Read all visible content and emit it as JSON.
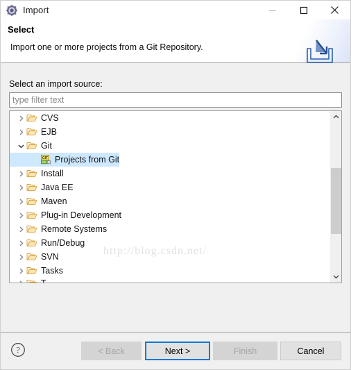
{
  "window": {
    "title": "Import",
    "icon": "eclipse-gear-icon",
    "controls": {
      "minimize": "minimize-icon",
      "maximize": "maximize-icon",
      "close": "close-icon"
    }
  },
  "header": {
    "title": "Select",
    "description": "Import one or more projects from a Git Repository.",
    "banner_icon": "import-arrow-icon"
  },
  "main": {
    "source_label": "Select an import source:",
    "filter": {
      "value": "",
      "placeholder": "type filter text"
    },
    "watermark": "http://blog.csdn.net/",
    "tree": [
      {
        "label": "CVS",
        "level": 0,
        "icon": "folder-icon",
        "expanded": false,
        "selected": false,
        "has_twisty": true
      },
      {
        "label": "EJB",
        "level": 0,
        "icon": "folder-icon",
        "expanded": false,
        "selected": false,
        "has_twisty": true
      },
      {
        "label": "Git",
        "level": 0,
        "icon": "folder-icon",
        "expanded": true,
        "selected": false,
        "has_twisty": true
      },
      {
        "label": "Projects from Git",
        "level": 1,
        "icon": "git-icon",
        "expanded": false,
        "selected": true,
        "has_twisty": false
      },
      {
        "label": "Install",
        "level": 0,
        "icon": "folder-icon",
        "expanded": false,
        "selected": false,
        "has_twisty": true
      },
      {
        "label": "Java EE",
        "level": 0,
        "icon": "folder-icon",
        "expanded": false,
        "selected": false,
        "has_twisty": true
      },
      {
        "label": "Maven",
        "level": 0,
        "icon": "folder-icon",
        "expanded": false,
        "selected": false,
        "has_twisty": true
      },
      {
        "label": "Plug-in Development",
        "level": 0,
        "icon": "folder-icon",
        "expanded": false,
        "selected": false,
        "has_twisty": true
      },
      {
        "label": "Remote Systems",
        "level": 0,
        "icon": "folder-icon",
        "expanded": false,
        "selected": false,
        "has_twisty": true
      },
      {
        "label": "Run/Debug",
        "level": 0,
        "icon": "folder-icon",
        "expanded": false,
        "selected": false,
        "has_twisty": true
      },
      {
        "label": "SVN",
        "level": 0,
        "icon": "folder-icon",
        "expanded": false,
        "selected": false,
        "has_twisty": true
      },
      {
        "label": "Tasks",
        "level": 0,
        "icon": "folder-icon",
        "expanded": false,
        "selected": false,
        "has_twisty": true
      }
    ],
    "tree_partial_row": {
      "label": "T",
      "level": 0,
      "icon": "folder-icon"
    },
    "scrollbar": {
      "up": "chevron-up-icon",
      "down": "chevron-down-icon",
      "thumb_position_pct": 33
    }
  },
  "footer": {
    "help_icon": "help-question-icon",
    "buttons": [
      {
        "name": "back",
        "label": "< Back",
        "state": "disabled"
      },
      {
        "name": "next",
        "label": "Next >",
        "state": "focused"
      },
      {
        "name": "finish",
        "label": "Finish",
        "state": "disabled"
      },
      {
        "name": "cancel",
        "label": "Cancel",
        "state": "enabled"
      }
    ]
  },
  "colors": {
    "accent": "#0078d7",
    "selection": "#cde8ff",
    "folder": "#e9b868",
    "dialog_bg": "#f0f0f0"
  }
}
